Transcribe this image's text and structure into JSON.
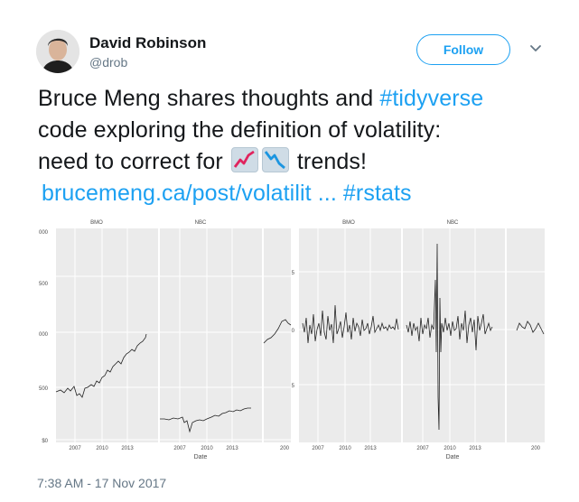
{
  "user": {
    "name": "David Robinson",
    "handle": "@drob"
  },
  "follow_label": "Follow",
  "tweet": {
    "line1_text": "Bruce Meng shares thoughts and ",
    "hashtag_tidyverse": "#tidyverse",
    "line2_text": "code exploring the definition of volatility:",
    "line3_text_before": "need to correct for ",
    "line3_text_after": " trends!",
    "link_text": "brucemeng.ca/post/volatilit ...",
    "hashtag_rstats": "#rstats",
    "emoji_up": "chart-increasing-emoji",
    "emoji_down": "chart-decreasing-emoji"
  },
  "timestamp": "7:38 AM - 17 Nov 2017",
  "colors": {
    "accent": "#1da1f2",
    "text": "#14171a",
    "muted": "#657786",
    "panel_bg": "#ebebeb"
  },
  "chart_data": [
    {
      "type": "line",
      "facets": [
        "BMO",
        "NBC",
        ""
      ],
      "y_ticks": [
        "000",
        "500",
        "000",
        "500",
        "$0"
      ],
      "x_ticks": [
        "2007",
        "2010",
        "2013",
        "2007",
        "2010",
        "2013",
        "200"
      ],
      "series": [
        {
          "facet": "BMO",
          "x": [
            2004.5,
            2005.5,
            2006.5,
            2007.5,
            2008.5,
            2009.5,
            2010.5,
            2011.5,
            2012.5,
            2013.5,
            2014.5,
            2015.2
          ],
          "y": [
            56,
            60,
            62,
            48,
            60,
            55,
            72,
            78,
            90,
            100,
            110,
            122
          ]
        },
        {
          "facet": "NBC",
          "x": [
            2004.5,
            2005.5,
            2006.5,
            2007.5,
            2008.5,
            2009.5,
            2010.5,
            2011.5,
            2012.5,
            2013.5,
            2014.5,
            2015.5
          ],
          "y": [
            20,
            21,
            21,
            16,
            22,
            20,
            25,
            28,
            30,
            33,
            35,
            37
          ]
        }
      ]
    },
    {
      "type": "line",
      "facets": [
        "BMO",
        "NBC",
        ""
      ],
      "y_ticks": [
        "5",
        "0",
        "5"
      ],
      "x_ticks": [
        "2007",
        "2010",
        "2013",
        "2007",
        "2010",
        "2013",
        "200"
      ],
      "xlabel": "Date"
    }
  ],
  "chart1_xlabel": "Date",
  "chart2_xlabel": "Date"
}
